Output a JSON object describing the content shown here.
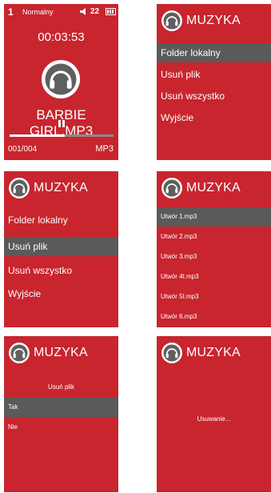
{
  "colors": {
    "screen_bg": "#c8252e",
    "selected_bg": "#5a5a5a",
    "text": "#ffffff",
    "page_bg": "#ffffff"
  },
  "player": {
    "status_number": "1",
    "mode": "Normalny",
    "volume": "22",
    "time": "00:03:53",
    "song": "BARBIE GIRL.MP3",
    "track": "001/004",
    "format": "MP3",
    "progress_fraction": 0.53,
    "icons": [
      "repeat-one-icon",
      "speaker-icon",
      "battery-icon",
      "headphones-icon",
      "pause-icon"
    ]
  },
  "menu_screen_a": {
    "title": "MUZYKA",
    "items": [
      "Folder lokalny",
      "Usuń plik",
      "Usuń wszystko",
      "Wyjście"
    ],
    "selected_index": 0
  },
  "menu_screen_b": {
    "title": "MUZYKA",
    "items": [
      "Folder lokalny",
      "Usuń plik",
      "Usuń wszystko",
      "Wyjście"
    ],
    "selected_index": 1
  },
  "file_list": {
    "title": "MUZYKA",
    "items": [
      "Utwór 1.mp3",
      "Utwór 2.mp3",
      "Utwór 3.mp3",
      "Utwór 4I.mp3",
      "Utwór 5I.mp3",
      "Utwór 6.mp3"
    ],
    "selected_index": 0
  },
  "confirm": {
    "title": "MUZYKA",
    "prompt": "Usuń plik",
    "options": [
      "Tak",
      "Nie"
    ],
    "selected_index": 0
  },
  "deleting": {
    "title": "MUZYKA",
    "message": "Usuwanie..."
  }
}
